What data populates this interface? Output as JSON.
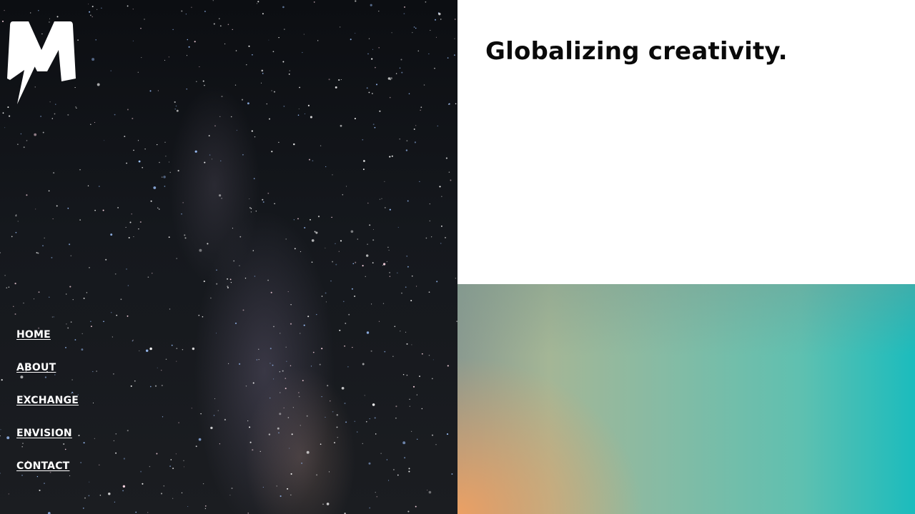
{
  "brand": {
    "logo_icon": "m-lightning-logo-icon",
    "logo_letter": "M"
  },
  "background": {
    "left_image": "starfield-milky-way-image"
  },
  "nav": {
    "items": [
      {
        "label": "HOME"
      },
      {
        "label": "ABOUT"
      },
      {
        "label": "EXCHANGE"
      },
      {
        "label": "ENVISION"
      },
      {
        "label": "CONTACT"
      }
    ]
  },
  "hero": {
    "headline": "Globalizing creativity."
  },
  "colors": {
    "text_dark": "#0a0a0a",
    "nav_text": "#ffffff",
    "gradient_orange": "#eca064",
    "gradient_teal": "#1bbcbd"
  }
}
